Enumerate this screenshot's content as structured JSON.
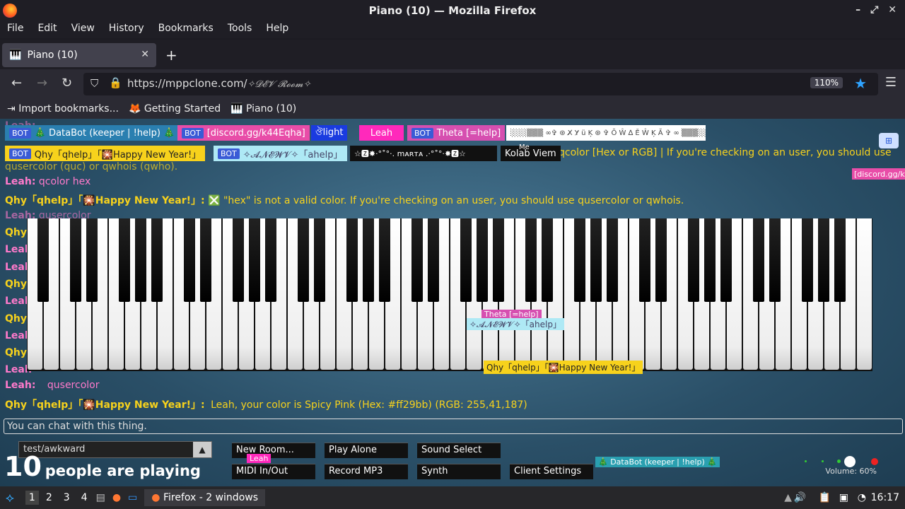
{
  "window": {
    "title": "Piano (10) — Mozilla Firefox"
  },
  "menu": [
    "File",
    "Edit",
    "View",
    "History",
    "Bookmarks",
    "Tools",
    "Help"
  ],
  "tab": {
    "label": "Piano (10)",
    "close": "✕"
  },
  "nav": {
    "url": "https://mppclone.com/",
    "room": "✧𝓓𝓔𝓥 𝓡𝓸𝓸𝓶✧",
    "zoom": "110%"
  },
  "bookmarks": [
    "Import bookmarks...",
    "Getting Started",
    "Piano (10)"
  ],
  "users": {
    "bot_label": "BOT",
    "databot": "🎄 DataBot (keeper | !help) 🎄",
    "discord": "[discord.gg/k44Eqha]",
    "light": "ঔlight",
    "leah": "Leah",
    "theta": "Theta [=help]",
    "glitch": "░░░▒▒▒ ∞✞ ⊛ X̸ Y̷ ü Ķ ⊛ ✞ Ŏ Ŵ ∆ Ě Ŵ Ķ Ă ✞ ∞ ▒▒▒░░░",
    "qhy": "Qhy「qhelp」「🎇Happy New Year!」",
    "anewv": "✧𝓐𝓝𝓔𝓦𝓥✧「ahelp」",
    "marta": "☆🆉✸·°˚°·. mᴀʀтᴀ .·°˚°·✸🆉☆",
    "kolab": "Kolab Viem",
    "me": "Me",
    "discord_short": "[discord.gg/k"
  },
  "chat": [
    {
      "name": "",
      "msg": "qcolor [Hex or RGB] | If you're checking on an user, you should use"
    },
    {
      "name": "",
      "msg": "qusercolor (quc) or qwhois (qwho)."
    },
    {
      "name": "Leah:",
      "msg": "qcolor hex"
    },
    {
      "name": "Qhy「qhelp」「🎇Happy New Year!」:",
      "msg": "❎ \"hex\" is not a valid color. If you're checking on an user, you should use qusercolor or qwhois."
    },
    {
      "name": "Leah:",
      "msg": "qusercolor"
    },
    {
      "name": "Leah:",
      "msg": "qusercolor"
    },
    {
      "name": "Qhy「qhelp」「🎇Happy New Year!」:",
      "msg": "Leah, your color is Spicy Pink (Hex: #ff29bb) (RGB: 255,41,187)"
    }
  ],
  "side_names": [
    "Qhy",
    "Leah",
    "Leah",
    "Qhy",
    "Leah",
    "Qhy",
    "Leah",
    "Qhy",
    "Leah"
  ],
  "piano_tags": {
    "theta": "Theta [=help]",
    "anewv": "✧𝓐𝓝𝓔𝓦𝓥✧「ahelp」",
    "qhy": "Qhy「qhelp」「🎇Happy New Year!」",
    "leah": "Leah",
    "databot": "🎄 DataBot (keeper | !help) 🎄"
  },
  "chat_input": {
    "placeholder": "You can chat with this thing."
  },
  "room_select": {
    "value": "test/awkward"
  },
  "player_count": {
    "number": "10",
    "text": "people are playing"
  },
  "buttons": {
    "new_room": "New Room...",
    "play_alone": "Play Alone",
    "sound_select": "Sound Select",
    "midi": "MIDI In/Out",
    "record": "Record MP3",
    "synth": "Synth",
    "client_settings": "Client Settings"
  },
  "volume": "Volume: 60%",
  "taskbar": {
    "workspaces": [
      "1",
      "2",
      "3",
      "4"
    ],
    "window": "Firefox - 2 windows",
    "clock": "16:17"
  },
  "colors": {
    "databot": "#2a7fb0",
    "discord": "#e84da8",
    "light": "#1a3be0",
    "leah": "#ff29bb",
    "theta": "#d64fb0",
    "qhy": "#f7d21c",
    "anewv": "#aee9f5",
    "marta": "#111111"
  }
}
